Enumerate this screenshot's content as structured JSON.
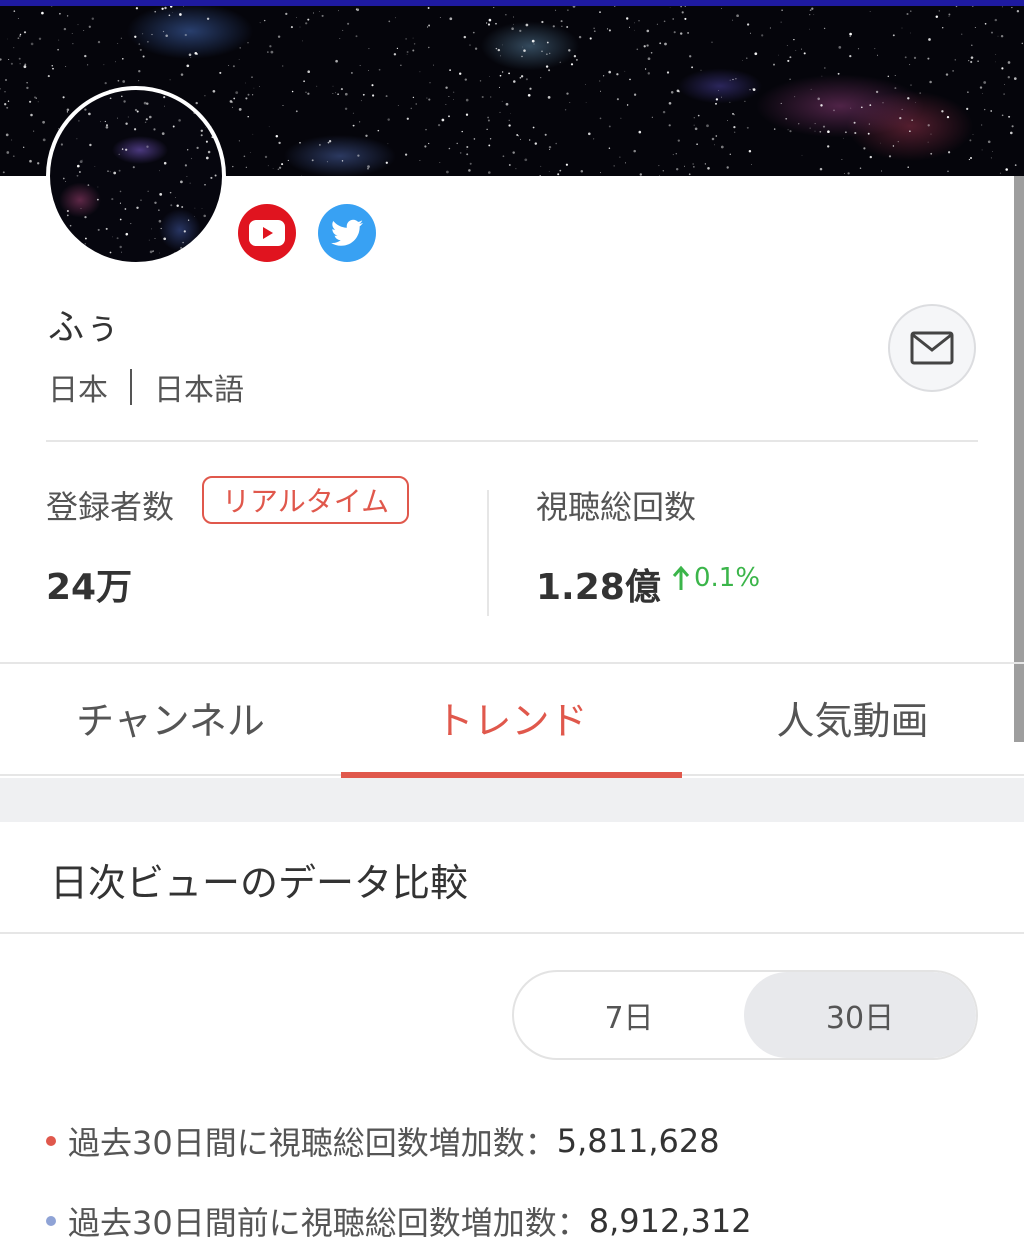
{
  "profile": {
    "name": "ふぅ",
    "country": "日本",
    "language": "日本語"
  },
  "social": {
    "youtube_icon": "youtube-icon",
    "twitter_icon": "twitter-icon"
  },
  "stats": {
    "subscribers_label": "登録者数",
    "realtime_badge": "リアルタイム",
    "subscribers_value": "24万",
    "views_label": "視聴総回数",
    "views_value": "1.28億",
    "views_change": "0.1%"
  },
  "tabs": [
    {
      "label": "チャンネル"
    },
    {
      "label": "トレンド"
    },
    {
      "label": "人気動画"
    }
  ],
  "active_tab": "トレンド",
  "trend": {
    "section_title": "日次ビューのデータ比較",
    "range_options": [
      "7日",
      "30日"
    ],
    "selected_range": "30日",
    "line1_label": "過去30日間に視聴総回数増加数：",
    "line1_value": "5,811,628",
    "line2_label": "過去30日間前に視聴総回数増加数：",
    "line2_value": "8,912,312"
  },
  "colors": {
    "accent": "#e0584c",
    "positive": "#3bb54a",
    "youtube": "#e0141f",
    "twitter": "#38a1f3",
    "series1_dot": "#e0584c",
    "series2_dot": "#8fa3d6"
  }
}
